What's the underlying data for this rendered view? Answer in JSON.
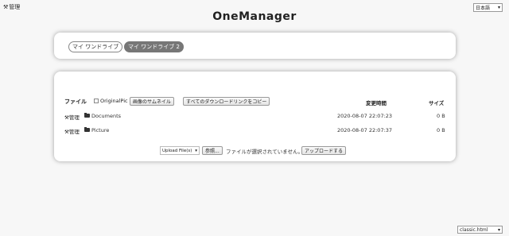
{
  "header": {
    "admin_icon": "wrench-icon",
    "admin_label": "管理",
    "language": "日本語",
    "title": "OneManager"
  },
  "drives": [
    {
      "label": "マイ ワンドライブ",
      "active": false
    },
    {
      "label": "マイ ワンドライブ 2",
      "active": true
    }
  ],
  "files": {
    "header": {
      "file_label": "ファイル",
      "original_pic_label": "OriginalPic",
      "thumbnail_button": "画像のサムネイル",
      "copy_links_button": "すべてのダウンロードリンクをコピー",
      "modified_label": "変更時間",
      "size_label": "サイズ"
    },
    "rows": [
      {
        "admin": "管理",
        "name": "Documents",
        "modified": "2020-08-07 22:07:23",
        "size": "0 B"
      },
      {
        "admin": "管理",
        "name": "Picture",
        "modified": "2020-08-07 22:07:37",
        "size": "0 B"
      }
    ]
  },
  "upload": {
    "mode": "Upload File(s)",
    "browse_button": "参照...",
    "no_file_text": "ファイルが選択されていません。",
    "upload_button": "アップロードする"
  },
  "theme": {
    "value": "classic.html"
  }
}
